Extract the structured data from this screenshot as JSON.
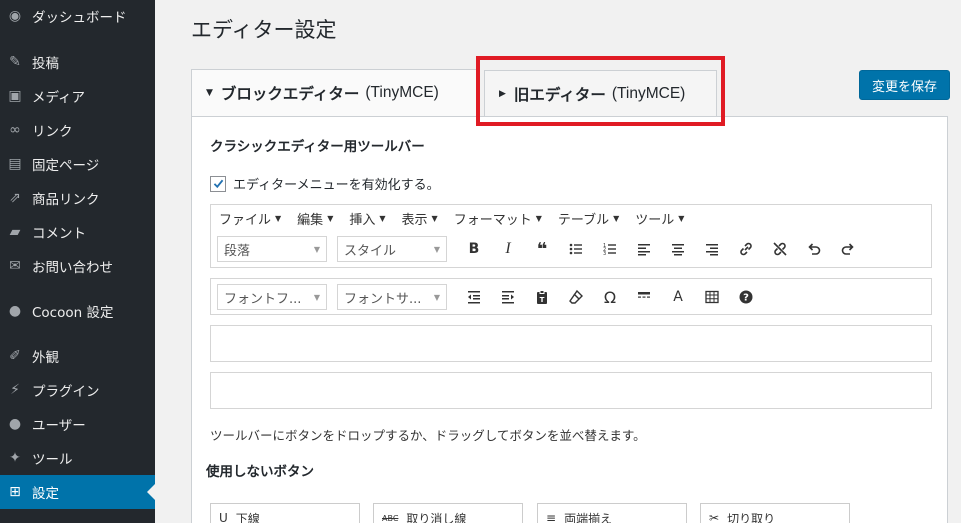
{
  "sidebar": {
    "items": [
      {
        "label": "ダッシュボード",
        "icon": "dashboard-icon",
        "glyph": "◉"
      },
      {
        "label": "投稿",
        "icon": "pin-icon",
        "glyph": "✎"
      },
      {
        "label": "メディア",
        "icon": "media-icon",
        "glyph": "▣"
      },
      {
        "label": "リンク",
        "icon": "link-icon",
        "glyph": "∞"
      },
      {
        "label": "固定ページ",
        "icon": "page-icon",
        "glyph": "▤"
      },
      {
        "label": "商品リンク",
        "icon": "external-icon",
        "glyph": "⇗"
      },
      {
        "label": "コメント",
        "icon": "comment-icon",
        "glyph": "▰"
      },
      {
        "label": "お問い合わせ",
        "icon": "mail-icon",
        "glyph": "✉"
      },
      {
        "label": "Cocoon 設定",
        "icon": "cocoon-icon",
        "glyph": "●"
      },
      {
        "label": "外観",
        "icon": "paintbrush-icon",
        "glyph": "✐"
      },
      {
        "label": "プラグイン",
        "icon": "plugin-icon",
        "glyph": "⚡"
      },
      {
        "label": "ユーザー",
        "icon": "user-icon",
        "glyph": "●"
      },
      {
        "label": "ツール",
        "icon": "wrench-icon",
        "glyph": "✦"
      },
      {
        "label": "設定",
        "icon": "settings-icon",
        "glyph": "⊞"
      }
    ]
  },
  "page": {
    "title": "エディター設定"
  },
  "tabs": [
    {
      "label": "ブロックエディター",
      "latin": "(TinyMCE)",
      "glyph": "▼"
    },
    {
      "label": "旧エディター",
      "latin": "(TinyMCE)",
      "glyph": "▶"
    }
  ],
  "save_button": "変更を保存",
  "section": {
    "title": "クラシックエディター用ツールバー"
  },
  "enable_menu": {
    "label": "エディターメニューを有効化する。",
    "checked": true
  },
  "menubar": [
    "ファイル",
    "編集",
    "挿入",
    "表示",
    "フォーマット",
    "テーブル",
    "ツール"
  ],
  "toolbar1": {
    "selects": [
      "段落",
      "スタイル"
    ],
    "buttons": [
      {
        "icon": "bold-icon",
        "glyph": "B"
      },
      {
        "icon": "italic-icon",
        "glyph": "I"
      },
      {
        "icon": "blockquote-icon",
        "glyph": "❝"
      },
      {
        "icon": "bullet-list-icon",
        "glyph": "☰"
      },
      {
        "icon": "numbered-list-icon",
        "glyph": "≡"
      },
      {
        "icon": "align-left-icon",
        "glyph": "≡"
      },
      {
        "icon": "align-center-icon",
        "glyph": "≡"
      },
      {
        "icon": "align-right-icon",
        "glyph": "≡"
      },
      {
        "icon": "link-icon",
        "glyph": "🔗"
      },
      {
        "icon": "unlink-icon",
        "glyph": "⛓"
      },
      {
        "icon": "undo-icon",
        "glyph": "↶"
      },
      {
        "icon": "redo-icon",
        "glyph": "↷"
      }
    ]
  },
  "toolbar2": {
    "selects": [
      "フォントフ...",
      "フォントサ..."
    ],
    "buttons": [
      {
        "icon": "outdent-icon",
        "glyph": "⇤"
      },
      {
        "icon": "indent-icon",
        "glyph": "⇥"
      },
      {
        "icon": "paste-text-icon",
        "glyph": "📋"
      },
      {
        "icon": "eraser-icon",
        "glyph": "⌫"
      },
      {
        "icon": "omega-icon",
        "glyph": "Ω"
      },
      {
        "icon": "horizontal-rule-icon",
        "glyph": "▬"
      },
      {
        "icon": "text-color-icon",
        "glyph": "A"
      },
      {
        "icon": "table-icon",
        "glyph": "▦"
      },
      {
        "icon": "help-icon",
        "glyph": "?"
      }
    ]
  },
  "help_text": "ツールバーにボタンをドロップするか、ドラッグしてボタンを並べ替えます。",
  "unused": {
    "title": "使用しないボタン",
    "buttons": [
      {
        "label": "下線",
        "glyph": "U"
      },
      {
        "label": "取り消し線",
        "glyph": "ABC"
      },
      {
        "label": "両端揃え",
        "glyph": "≡"
      },
      {
        "label": "切り取り",
        "glyph": "✂"
      }
    ]
  }
}
